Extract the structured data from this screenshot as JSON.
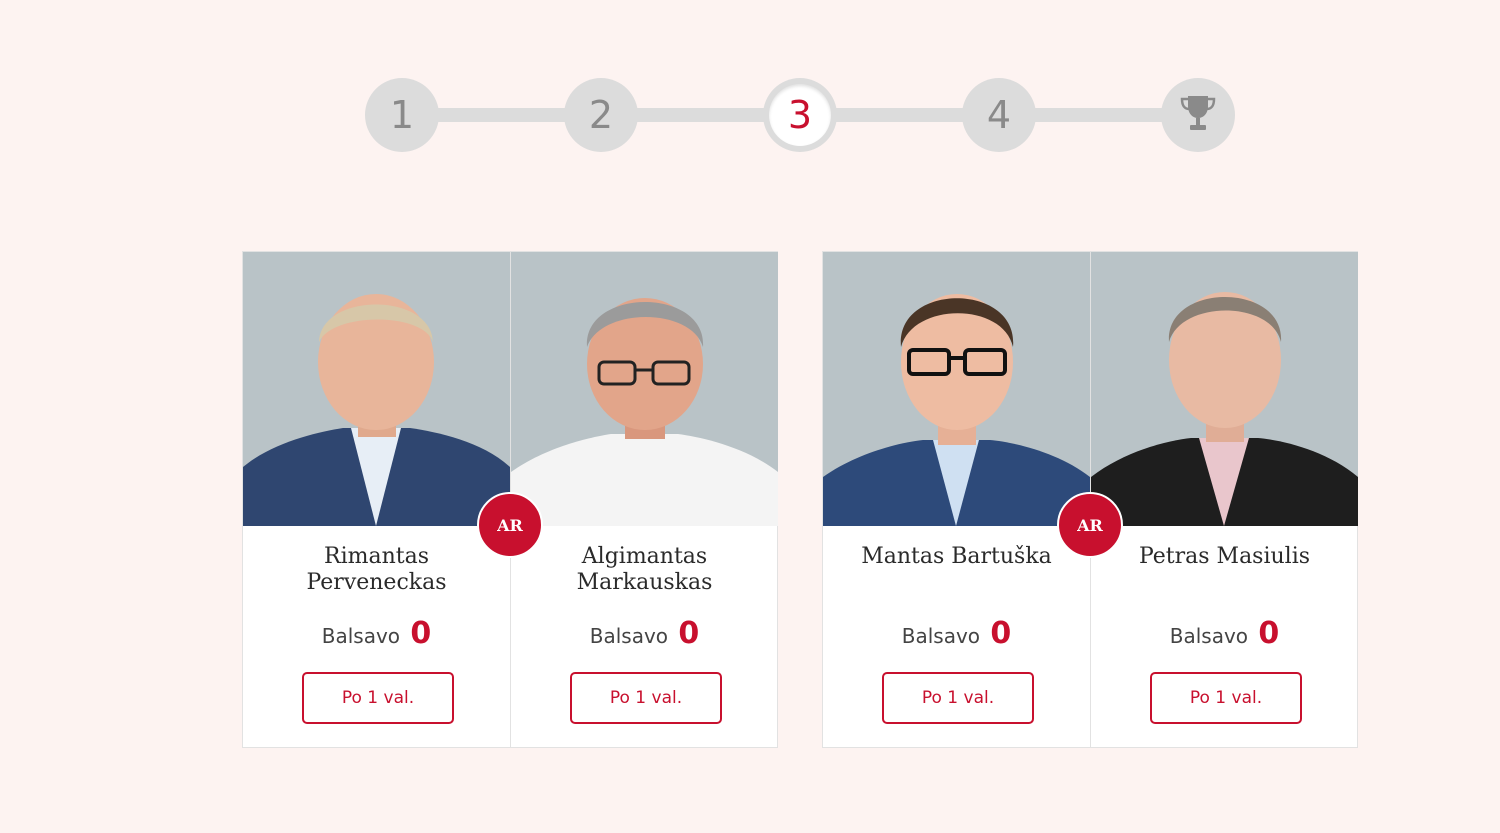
{
  "stepper": {
    "steps": [
      {
        "label": "1",
        "state": "inactive"
      },
      {
        "label": "2",
        "state": "inactive"
      },
      {
        "label": "3",
        "state": "active"
      },
      {
        "label": "4",
        "state": "inactive"
      }
    ],
    "final_icon": "trophy-icon"
  },
  "colors": {
    "accent": "#c8102e",
    "background": "#fdf3f1",
    "photo_bg": "#b9c3c7",
    "stepper_grey": "#dcdcdc"
  },
  "matchups": [
    {
      "badge": "AR",
      "candidates": [
        {
          "name": "Rimantas Perveneckas",
          "votes_label": "Balsavo",
          "votes": "0",
          "button": "Po 1 val.",
          "photo": "portrait-photo"
        },
        {
          "name": "Algimantas Markauskas",
          "votes_label": "Balsavo",
          "votes": "0",
          "button": "Po 1 val.",
          "photo": "portrait-photo"
        }
      ]
    },
    {
      "badge": "AR",
      "candidates": [
        {
          "name": "Mantas Bartuška",
          "votes_label": "Balsavo",
          "votes": "0",
          "button": "Po 1 val.",
          "photo": "portrait-photo"
        },
        {
          "name": "Petras Masiulis",
          "votes_label": "Balsavo",
          "votes": "0",
          "button": "Po 1 val.",
          "photo": "portrait-photo"
        }
      ]
    }
  ]
}
